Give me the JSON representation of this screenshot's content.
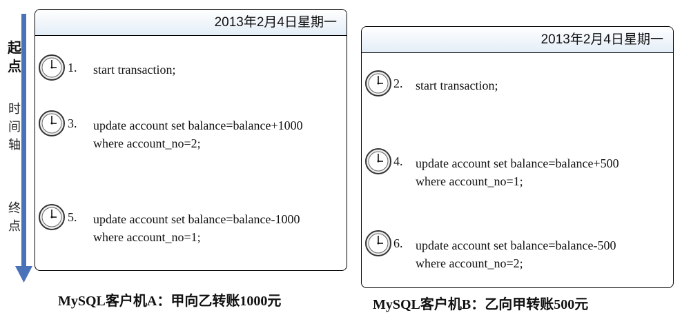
{
  "timeline": {
    "start": [
      "起",
      "点"
    ],
    "axis": [
      "时",
      "间",
      "轴"
    ],
    "end": [
      "终",
      "点"
    ],
    "color": "#4a72b8"
  },
  "client_a": {
    "date": "2013年2月4日星期一",
    "steps": [
      {
        "num": "1.",
        "lines": [
          "start transaction;"
        ]
      },
      {
        "num": "3.",
        "lines": [
          "update account set balance=balance+1000",
          "where account_no=2;"
        ]
      },
      {
        "num": "5.",
        "lines": [
          "update account set balance=balance-1000",
          "where account_no=1;"
        ]
      }
    ],
    "caption": "MySQL客户机A：甲向乙转账1000元"
  },
  "client_b": {
    "date": "2013年2月4日星期一",
    "steps": [
      {
        "num": "2.",
        "lines": [
          "start transaction;"
        ]
      },
      {
        "num": "4.",
        "lines": [
          "update account set balance=balance+500",
          "where account_no=1;"
        ]
      },
      {
        "num": "6.",
        "lines": [
          "update account set balance=balance-500",
          "where account_no=2;"
        ]
      }
    ],
    "caption": "MySQL客户机B：乙向甲转账500元"
  }
}
